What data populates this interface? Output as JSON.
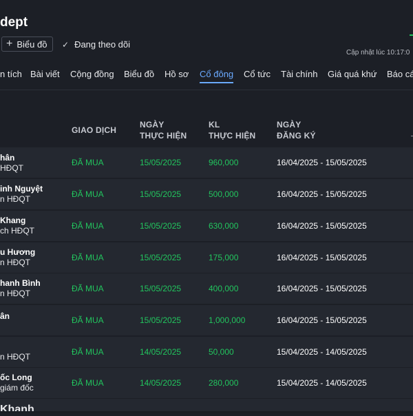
{
  "header": {
    "title": "dept",
    "add_chart_label": "Biểu đồ",
    "follow_label": "Đang theo dõi",
    "updated_label": "Cập nhật lúc  10:17:0"
  },
  "tabs": [
    {
      "label": "n tích"
    },
    {
      "label": "Bài viết"
    },
    {
      "label": "Cộng đồng"
    },
    {
      "label": "Biểu đồ"
    },
    {
      "label": "Hồ sơ"
    },
    {
      "label": "Cổ đông",
      "active": true
    },
    {
      "label": "Cổ tức"
    },
    {
      "label": "Tài chính"
    },
    {
      "label": "Giá quá khứ"
    },
    {
      "label": "Báo cá"
    }
  ],
  "table": {
    "headers": {
      "transaction": "GIAO DỊCH",
      "exec_date_1": "NGÀY",
      "exec_date_2": "THỰC HIỆN",
      "volume_1": "KL",
      "volume_2": "THỰC HIỆN",
      "reg_date_1": "NGÀY",
      "reg_date_2": "ĐĂNG KÝ"
    },
    "rows": [
      {
        "name": "hân",
        "role": "HĐQT",
        "transaction": "ĐÃ MUA",
        "exec_date": "15/05/2025",
        "volume": "960,000",
        "reg_period": "16/04/2025 - 15/05/2025"
      },
      {
        "name": "inh Nguyệt",
        "role": "n HĐQT",
        "transaction": "ĐÃ MUA",
        "exec_date": "15/05/2025",
        "volume": "500,000",
        "reg_period": "16/04/2025 - 15/05/2025"
      },
      {
        "name": "Khang",
        "role": "ch HĐQT",
        "transaction": "ĐÃ MUA",
        "exec_date": "15/05/2025",
        "volume": "630,000",
        "reg_period": "16/04/2025 - 15/05/2025"
      },
      {
        "name": "u Hương",
        "role": "n HĐQT",
        "transaction": "ĐÃ MUA",
        "exec_date": "15/05/2025",
        "volume": "175,000",
        "reg_period": "16/04/2025 - 15/05/2025"
      },
      {
        "name": "hanh Bình",
        "role": "n HĐQT",
        "transaction": "ĐÃ MUA",
        "exec_date": "15/05/2025",
        "volume": "400,000",
        "reg_period": "16/04/2025 - 15/05/2025"
      },
      {
        "name": "ân",
        "role": "",
        "transaction": "ĐÃ MUA",
        "exec_date": "15/05/2025",
        "volume": "1,000,000",
        "reg_period": "16/04/2025 - 15/05/2025"
      },
      {
        "name": "",
        "role": "n HĐQT",
        "transaction": "ĐÃ MUA",
        "exec_date": "14/05/2025",
        "volume": "50,000",
        "reg_period": "15/04/2025 - 14/05/2025"
      },
      {
        "name": "ốc Long",
        "role": "giám đốc",
        "transaction": "ĐÃ MUA",
        "exec_date": "14/05/2025",
        "volume": "280,000",
        "reg_period": "15/04/2025 - 14/05/2025"
      },
      {
        "name": "Khanh",
        "role": "",
        "transaction": "",
        "exec_date": "",
        "volume": "",
        "reg_period": ""
      }
    ]
  },
  "colors": {
    "background": "#1c1f26",
    "row_background": "#242830",
    "accent": "#6aa9ff",
    "buy_green": "#22c55e"
  }
}
